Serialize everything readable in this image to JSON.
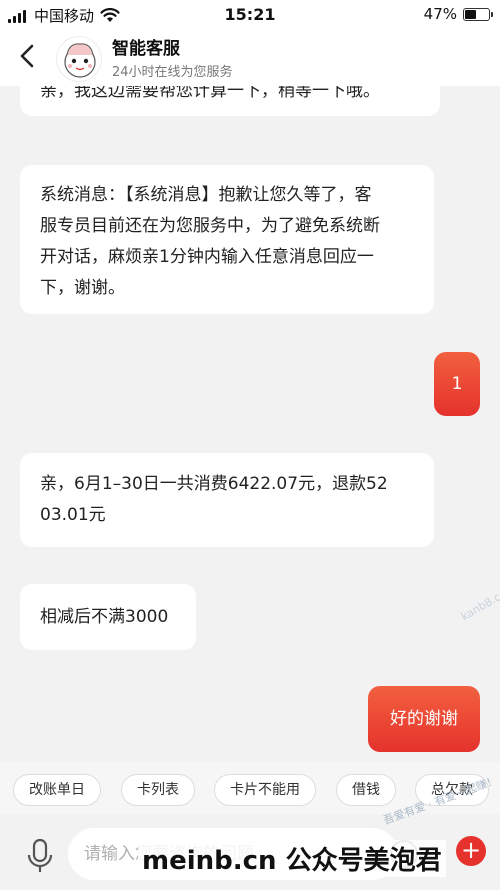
{
  "status_bar": {
    "carrier": "中国移动",
    "time": "15:21",
    "battery": "47%",
    "battery_level": 0.47
  },
  "nav": {
    "title": "智能客服",
    "subtitle": "24小时在线为您服务"
  },
  "messages": [
    {
      "side": "left",
      "text": "亲，我这边需要帮您计算一下，稍等一下哦。"
    },
    {
      "side": "left",
      "lines": [
        "系统消息：【系统消息】抱歉让您久等了，客",
        "服专员目前还在为您服务中，为了避免系统断",
        "开对话，麻烦亲1分钟内输入任意消息回应一",
        "下，谢谢。"
      ]
    },
    {
      "side": "right",
      "text": "1"
    },
    {
      "side": "left",
      "lines": [
        "亲，6月1–30日一共消费6422.07元，退款52",
        "03.01元"
      ]
    },
    {
      "side": "left",
      "text": "相减后不满3000"
    },
    {
      "side": "right",
      "text": "好的谢谢"
    }
  ],
  "quick_replies": [
    "改账单日",
    "卡列表",
    "卡片不能用",
    "借钱",
    "总欠款"
  ],
  "input": {
    "placeholder": "请输入您要咨询的问题"
  },
  "watermark": "meinb.cn  公众号美泡君",
  "stamp": "吾爱有爱 · 有爱一起赚！",
  "stamp2": "kanb8.com"
}
